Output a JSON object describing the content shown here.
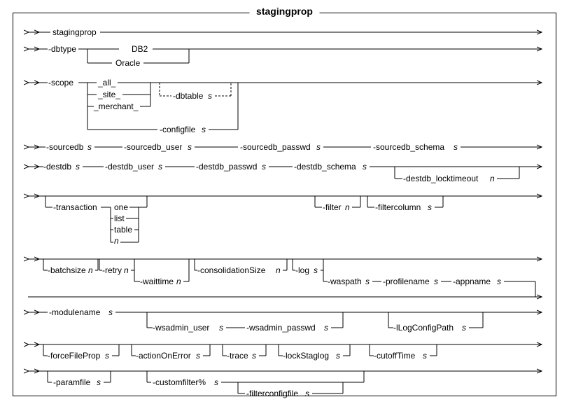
{
  "title": "stagingprop",
  "tokens": {
    "cmd": "stagingprop",
    "dbtype": {
      "flag": "-dbtype",
      "opts": [
        "DB2",
        "Oracle"
      ]
    },
    "scope": {
      "flag": "-scope",
      "opts": [
        "_all_",
        "_site_",
        "_merchant_"
      ],
      "dbtable": {
        "flag": "-dbtable",
        "param": "s"
      },
      "configfile": {
        "flag": "-configfile",
        "param": "s"
      }
    },
    "sourcedb": {
      "flag": "-sourcedb",
      "param": "s"
    },
    "sourcedb_user": {
      "flag": "-sourcedb_user",
      "param": "s"
    },
    "sourcedb_passwd": {
      "flag": "-sourcedb_passwd",
      "param": "s"
    },
    "sourcedb_schema": {
      "flag": "-sourcedb_schema",
      "param": "s"
    },
    "destdb": {
      "flag": "-destdb",
      "param": "s"
    },
    "destdb_user": {
      "flag": "-destdb_user",
      "param": "s"
    },
    "destdb_passwd": {
      "flag": "-destdb_passwd",
      "param": "s"
    },
    "destdb_schema": {
      "flag": "-destdb_schema",
      "param": "s"
    },
    "destdb_locktimeout": {
      "flag": "-destdb_locktimeout",
      "param": "n"
    },
    "transaction": {
      "flag": "-transaction",
      "opts": [
        "one",
        "list",
        "table",
        "n"
      ]
    },
    "filter": {
      "flag": "-filter",
      "param": "n"
    },
    "filtercolumn": {
      "flag": "-filtercolumn",
      "param": "s"
    },
    "batchsize": {
      "flag": "-batchsize",
      "param": "n"
    },
    "retry": {
      "flag": "-retry",
      "param": "n"
    },
    "waittime": {
      "flag": "-waittime",
      "param": "n"
    },
    "consolidationSize": {
      "flag": "-consolidationSize",
      "param": "n"
    },
    "log": {
      "flag": "-log",
      "param": "s"
    },
    "waspath": {
      "flag": "-waspath",
      "param": "s"
    },
    "profilename": {
      "flag": "-profilename",
      "param": "s"
    },
    "appname": {
      "flag": "-appname",
      "param": "s"
    },
    "modulename": {
      "flag": "-modulename",
      "param": "s"
    },
    "wsadmin_user": {
      "flag": "-wsadmin_user",
      "param": "s"
    },
    "wsadmin_passwd": {
      "flag": "-wsadmin_passwd",
      "param": "s"
    },
    "lLogConfigPath": {
      "flag": "-lLogConfigPath",
      "param": "s"
    },
    "forceFileProp": {
      "flag": "-forceFileProp",
      "param": "s"
    },
    "actionOnError": {
      "flag": "-actionOnError",
      "param": "s"
    },
    "trace": {
      "flag": "-trace",
      "param": "s"
    },
    "lockStaglog": {
      "flag": "-lockStaglog",
      "param": "s"
    },
    "cutoffTime": {
      "flag": "-cutoffTime",
      "param": "s"
    },
    "paramfile": {
      "flag": "-paramfile",
      "param": "s"
    },
    "customfilter": {
      "flag": "-customfilter%",
      "param": "s"
    },
    "filterconfigfile": {
      "flag": "-filterconfigfile",
      "param": "s"
    }
  }
}
